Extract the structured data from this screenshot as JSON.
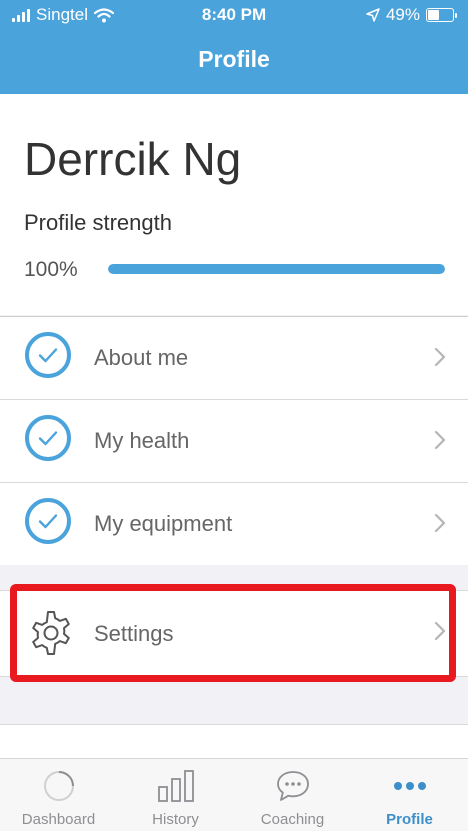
{
  "status_bar": {
    "carrier": "Singtel",
    "time": "8:40 PM",
    "battery": "49%"
  },
  "header": {
    "title": "Profile"
  },
  "profile": {
    "name": "Derrcik Ng",
    "strength_label": "Profile strength",
    "strength_value": "100%",
    "strength_fraction": 1.0
  },
  "sections": [
    {
      "label": "About me"
    },
    {
      "label": "My health"
    },
    {
      "label": "My equipment"
    }
  ],
  "settings": {
    "label": "Settings"
  },
  "tabs": [
    {
      "label": "Dashboard",
      "icon": "dashboard-icon"
    },
    {
      "label": "History",
      "icon": "history-icon"
    },
    {
      "label": "Coaching",
      "icon": "coaching-icon"
    },
    {
      "label": "Profile",
      "icon": "profile-icon",
      "active": true
    }
  ],
  "colors": {
    "accent": "#4ba3dc",
    "highlight": "#e8191f"
  }
}
